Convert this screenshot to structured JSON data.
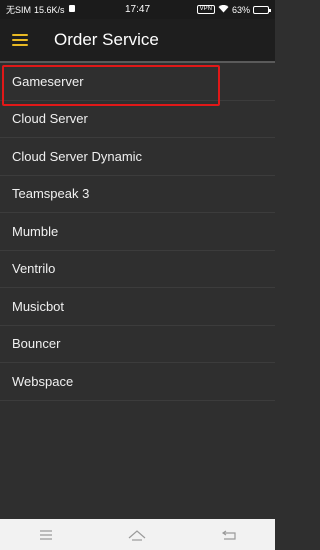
{
  "status_bar": {
    "carrier": "无SIM",
    "speed": "15.6K/s",
    "time": "17:47",
    "network_badge": "VPN",
    "battery": "63%",
    "battery_level": 0.63
  },
  "app_bar": {
    "title": "Order Service",
    "accent_color": "#e8b923"
  },
  "services": [
    {
      "label": "Gameserver",
      "highlighted": true
    },
    {
      "label": "Cloud Server"
    },
    {
      "label": "Cloud Server Dynamic"
    },
    {
      "label": "Teamspeak 3"
    },
    {
      "label": "Mumble"
    },
    {
      "label": "Ventrilo"
    },
    {
      "label": "Musicbot"
    },
    {
      "label": "Bouncer"
    },
    {
      "label": "Webspace"
    }
  ],
  "nav_bar": {
    "icons": [
      "menu-icon",
      "home-icon",
      "back-icon"
    ]
  }
}
